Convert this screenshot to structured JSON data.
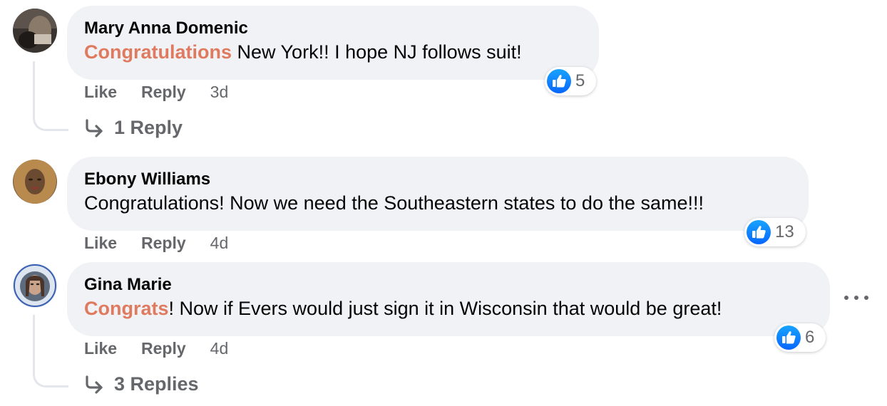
{
  "comments": [
    {
      "author": "Mary Anna Domenic",
      "highlight": "Congratulations",
      "text": " New York!! I hope NJ follows suit!",
      "reaction_count": "5",
      "like_label": "Like",
      "reply_label": "Reply",
      "time": "3d",
      "replies_label": "1 Reply"
    },
    {
      "author": "Ebony Williams",
      "text": "Congratulations! Now we need the Southeastern states to do the same!!!",
      "reaction_count": "13",
      "like_label": "Like",
      "reply_label": "Reply",
      "time": "4d"
    },
    {
      "author": "Gina Marie",
      "highlight": "Congrats",
      "text": "! Now if Evers would just sign it in Wisconsin that would be great!",
      "reaction_count": "6",
      "like_label": "Like",
      "reply_label": "Reply",
      "time": "4d",
      "replies_label": "3 Replies"
    }
  ],
  "colors": {
    "bubble": "#f0f2f5",
    "link_highlight": "#e07a5f",
    "like_blue": "#1877f2",
    "muted": "#65676b"
  },
  "icons": {
    "reaction": "thumbs-up-icon",
    "reply_arrow": "reply-arrow-icon",
    "menu": "more-options-icon"
  }
}
